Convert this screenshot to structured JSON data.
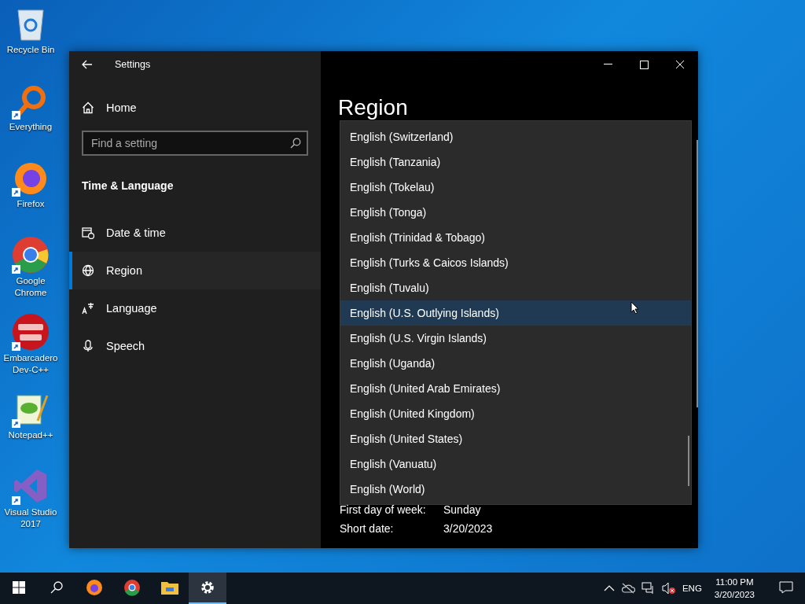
{
  "desktop_icons": [
    {
      "label": "Recycle Bin",
      "kind": "bin",
      "shortcut": false
    },
    {
      "label": "Everything",
      "kind": "magnifier",
      "shortcut": true
    },
    {
      "label": "Firefox",
      "kind": "firefox",
      "shortcut": true
    },
    {
      "label": "Google Chrome",
      "kind": "chrome",
      "shortcut": true
    },
    {
      "label": "Embarcadero Dev-C++",
      "kind": "devcpp",
      "shortcut": true
    },
    {
      "label": "Notepad++",
      "kind": "notepad",
      "shortcut": true
    },
    {
      "label": "Visual Studio 2017",
      "kind": "vs",
      "shortcut": true
    }
  ],
  "window": {
    "title": "Settings",
    "sidebar": {
      "home": "Home",
      "search": {
        "placeholder": "Find a setting"
      },
      "section": "Time & Language",
      "items": [
        {
          "label": "Date & time",
          "kind": "calendar",
          "selected": false
        },
        {
          "label": "Region",
          "kind": "globe",
          "selected": true
        },
        {
          "label": "Language",
          "kind": "language",
          "selected": false
        },
        {
          "label": "Speech",
          "kind": "microphone",
          "selected": false
        }
      ]
    },
    "page": {
      "title": "Region",
      "dropdown": {
        "options": [
          {
            "label": "English (Switzerland)",
            "selected": false
          },
          {
            "label": "English (Tanzania)",
            "selected": false
          },
          {
            "label": "English (Tokelau)",
            "selected": false
          },
          {
            "label": "English (Tonga)",
            "selected": false
          },
          {
            "label": "English (Trinidad & Tobago)",
            "selected": false
          },
          {
            "label": "English (Turks & Caicos Islands)",
            "selected": false
          },
          {
            "label": "English (Tuvalu)",
            "selected": false
          },
          {
            "label": "English (U.S. Outlying Islands)",
            "selected": true
          },
          {
            "label": "English (U.S. Virgin Islands)",
            "selected": false
          },
          {
            "label": "English (Uganda)",
            "selected": false
          },
          {
            "label": "English (United Arab Emirates)",
            "selected": false
          },
          {
            "label": "English (United Kingdom)",
            "selected": false
          },
          {
            "label": "English (United States)",
            "selected": false
          },
          {
            "label": "English (Vanuatu)",
            "selected": false
          },
          {
            "label": "English (World)",
            "selected": false
          }
        ]
      },
      "details": [
        {
          "label": "First day of week:",
          "value": "Sunday"
        },
        {
          "label": "Short date:",
          "value": "3/20/2023"
        }
      ]
    }
  },
  "taskbar": {
    "apps": [
      {
        "kind": "firefox",
        "active": false
      },
      {
        "kind": "chrome",
        "active": false
      },
      {
        "kind": "folder",
        "active": false
      },
      {
        "kind": "gear",
        "active": true
      }
    ],
    "language": "ENG",
    "time": "11:00 PM",
    "date": "3/20/2023"
  }
}
